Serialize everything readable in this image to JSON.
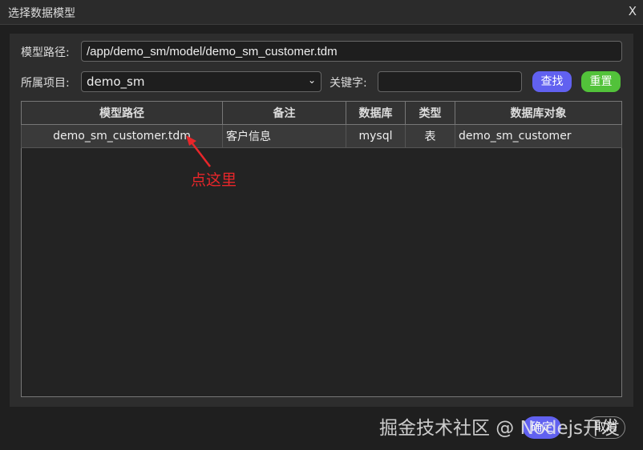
{
  "window": {
    "title": "选择数据模型",
    "close": "X"
  },
  "form": {
    "model_path_label": "模型路径:",
    "model_path_value": "/app/demo_sm/model/demo_sm_customer.tdm",
    "project_label": "所属项目:",
    "project_value": "demo_sm",
    "keyword_label": "关键字:",
    "keyword_value": "",
    "search": "查找",
    "reset": "重置"
  },
  "table": {
    "headers": [
      "模型路径",
      "备注",
      "数据库",
      "类型",
      "数据库对象"
    ],
    "rows": [
      {
        "path": "demo_sm_customer.tdm",
        "remark": "客户信息",
        "db": "mysql",
        "type": "表",
        "object": "demo_sm_customer"
      }
    ]
  },
  "annotation": "点这里",
  "footer": {
    "ok": "确定",
    "cancel": "取消"
  },
  "watermark": "掘金技术社区 @ Nodejs开发"
}
